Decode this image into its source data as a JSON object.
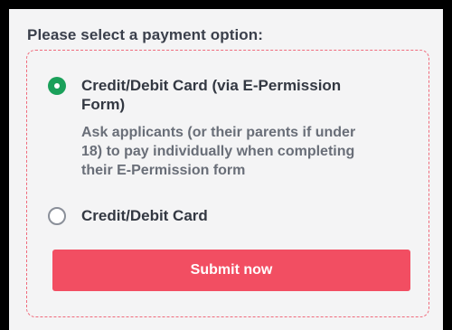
{
  "heading": "Please select a payment option:",
  "options": [
    {
      "label": "Credit/Debit Card (via E-Permission Form)",
      "description": "Ask applicants (or their parents if under 18) to pay individually when completing their E-Permission form",
      "selected": true
    },
    {
      "label": "Credit/Debit Card",
      "selected": false
    }
  ],
  "submit_label": "Submit now",
  "colors": {
    "accent_green": "#1aa05a",
    "submit_red": "#f24e62",
    "border_dashed": "#f06b7c"
  }
}
